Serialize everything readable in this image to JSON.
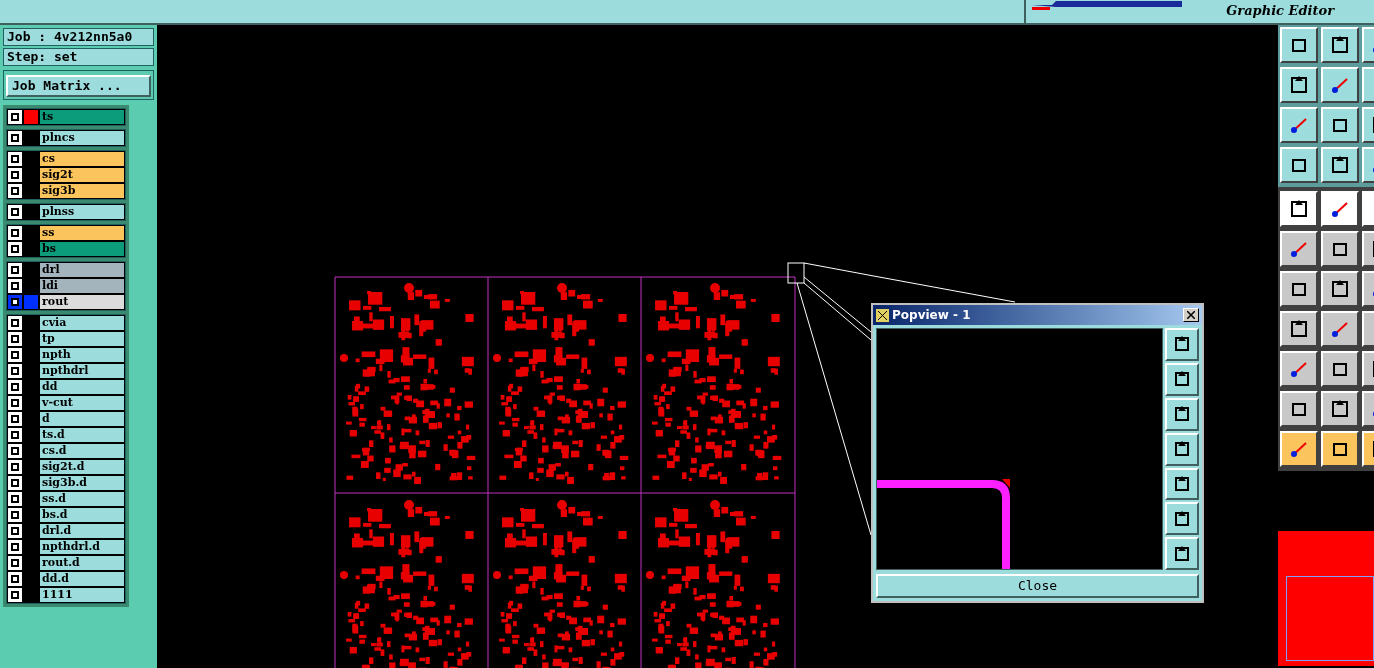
{
  "header": {
    "subtitle": "Graphic Editor"
  },
  "job": {
    "job_label": "Job : 4v212nn5a0",
    "step_label": "Step: set",
    "matrix_button": "Job Matrix ..."
  },
  "layer_groups": [
    [
      {
        "name": "ts",
        "color": "#0c9c7c",
        "checked": true,
        "work": true,
        "selected": false
      }
    ],
    [
      {
        "name": "plncs",
        "color": "#9cdcdc",
        "checked": true,
        "work": false,
        "selected": false
      }
    ],
    [
      {
        "name": "cs",
        "color": "#fcc45c",
        "checked": true,
        "work": false,
        "selected": false
      },
      {
        "name": "sig2t",
        "color": "#fcc45c",
        "checked": true,
        "work": false,
        "selected": false
      },
      {
        "name": "sig3b",
        "color": "#fcc45c",
        "checked": true,
        "work": false,
        "selected": false
      }
    ],
    [
      {
        "name": "plnss",
        "color": "#9cdcdc",
        "checked": true,
        "work": false,
        "selected": false
      }
    ],
    [
      {
        "name": "ss",
        "color": "#fcc45c",
        "checked": true,
        "work": false,
        "selected": false
      },
      {
        "name": "bs",
        "color": "#0c9c7c",
        "checked": true,
        "work": false,
        "selected": false
      }
    ],
    [
      {
        "name": "drl",
        "color": "#a4b4bc",
        "checked": true,
        "work": false,
        "selected": false
      },
      {
        "name": "ldi",
        "color": "#a4b4bc",
        "checked": true,
        "work": false,
        "selected": false
      },
      {
        "name": "rout",
        "color": "#dcdcdc",
        "checked": true,
        "work": false,
        "selected": true
      }
    ],
    [
      {
        "name": "cvia",
        "color": "#9cdcdc",
        "checked": true,
        "work": false,
        "selected": false
      },
      {
        "name": "tp",
        "color": "#9cdcdc",
        "checked": true,
        "work": false,
        "selected": false
      },
      {
        "name": "npth",
        "color": "#9cdcdc",
        "checked": true,
        "work": false,
        "selected": false
      },
      {
        "name": "npthdrl",
        "color": "#9cdcdc",
        "checked": true,
        "work": false,
        "selected": false
      },
      {
        "name": "dd",
        "color": "#9cdcdc",
        "checked": true,
        "work": false,
        "selected": false
      },
      {
        "name": "v-cut",
        "color": "#9cdcdc",
        "checked": true,
        "work": false,
        "selected": false
      },
      {
        "name": "d",
        "color": "#9cdcdc",
        "checked": true,
        "work": false,
        "selected": false
      },
      {
        "name": "ts.d",
        "color": "#9cdcdc",
        "checked": true,
        "work": false,
        "selected": false
      },
      {
        "name": "cs.d",
        "color": "#9cdcdc",
        "checked": true,
        "work": false,
        "selected": false
      },
      {
        "name": "sig2t.d",
        "color": "#9cdcdc",
        "checked": true,
        "work": false,
        "selected": false
      },
      {
        "name": "sig3b.d",
        "color": "#9cdcdc",
        "checked": true,
        "work": false,
        "selected": false
      },
      {
        "name": "ss.d",
        "color": "#9cdcdc",
        "checked": true,
        "work": false,
        "selected": false
      },
      {
        "name": "bs.d",
        "color": "#9cdcdc",
        "checked": true,
        "work": false,
        "selected": false
      },
      {
        "name": "drl.d",
        "color": "#9cdcdc",
        "checked": true,
        "work": false,
        "selected": false
      },
      {
        "name": "npthdrl.d",
        "color": "#9cdcdc",
        "checked": true,
        "work": false,
        "selected": false
      },
      {
        "name": "rout.d",
        "color": "#9cdcdc",
        "checked": true,
        "work": false,
        "selected": false
      },
      {
        "name": "dd.d",
        "color": "#9cdcdc",
        "checked": true,
        "work": false,
        "selected": false
      },
      {
        "name": "1111",
        "color": "#9cdcdc",
        "checked": true,
        "work": false,
        "selected": false
      }
    ]
  ],
  "popview": {
    "title": "Popview - 1",
    "close_button": "Close"
  }
}
